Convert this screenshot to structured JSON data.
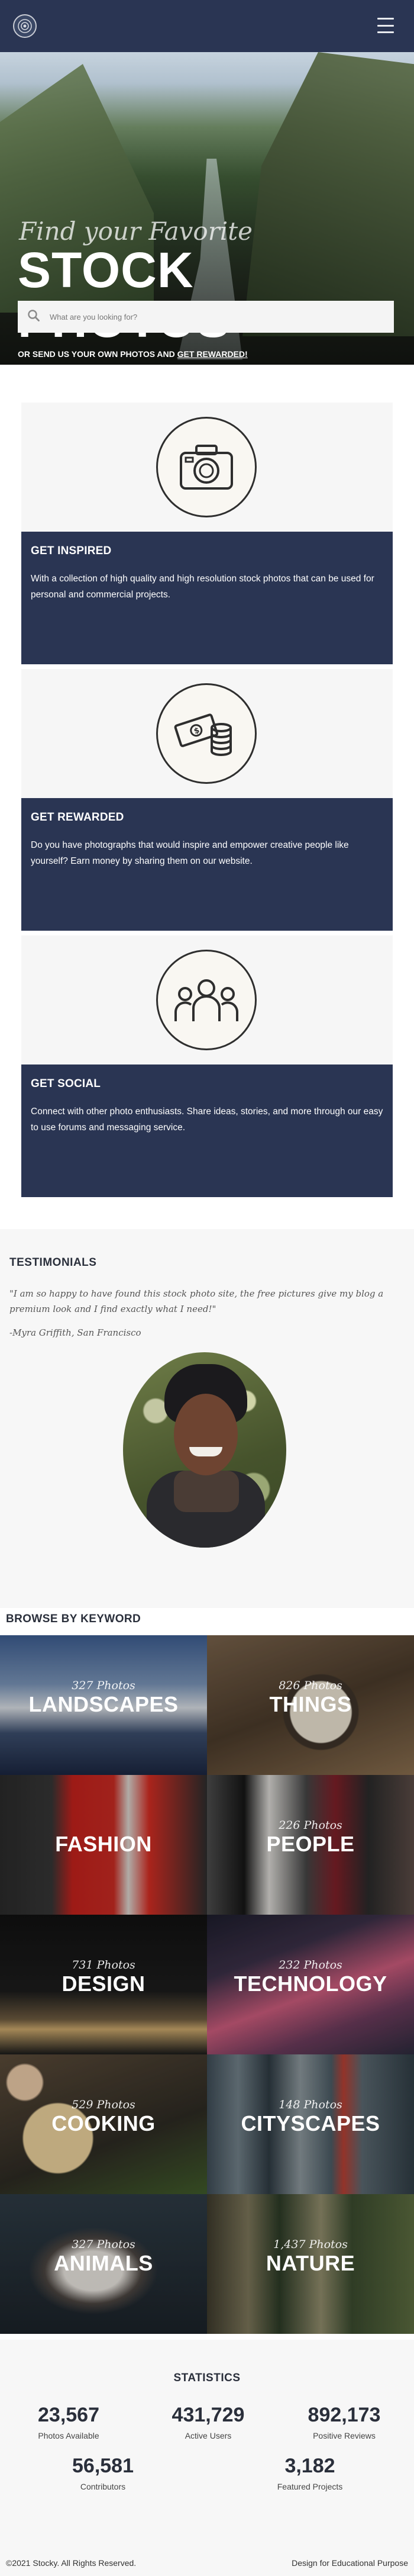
{
  "header": {
    "logo_icon": "camera-aperture-logo",
    "menu_icon": "hamburger-menu-icon",
    "background": "#2a3553"
  },
  "hero": {
    "subtitle": "Find your Favorite",
    "title": "STOCK PHOTOS",
    "search_placeholder": "What are you looking for?",
    "cta_text": "OR SEND US YOUR OWN PHOTOS AND ",
    "cta_link": "GET REWARDED!"
  },
  "features": [
    {
      "icon": "camera-icon",
      "title": "GET INSPIRED",
      "text": "With a collection of high quality and high resolution stock photos that can be used for personal and commercial projects."
    },
    {
      "icon": "money-coins-icon",
      "title": "GET REWARDED",
      "text": "Do you have photographs that would inspire and empower creative people like yourself? Earn money by sharing them on our website."
    },
    {
      "icon": "people-group-icon",
      "title": "GET SOCIAL",
      "text": "Connect with other photo enthusiasts. Share ideas, stories, and more through our easy to use forums and messaging service."
    }
  ],
  "testimonials": {
    "heading": "TESTIMONIALS",
    "quote": "\"I am so happy to have found this stock photo site, the free pictures give my blog a premium look and I find exactly what I need!\"",
    "author": "-Myra Griffith, San Francisco"
  },
  "keywords": {
    "heading": "BROWSE BY KEYWORD",
    "tiles": [
      {
        "count": "327 Photos",
        "name": "LANDSCAPES"
      },
      {
        "count": "826 Photos",
        "name": "THINGS"
      },
      {
        "count": "",
        "name": "FASHION"
      },
      {
        "count": "226 Photos",
        "name": "PEOPLE"
      },
      {
        "count": "731 Photos",
        "name": "DESIGN"
      },
      {
        "count": "232 Photos",
        "name": "TECHNOLOGY"
      },
      {
        "count": "529 Photos",
        "name": "COOKING"
      },
      {
        "count": "148 Photos",
        "name": "CITYSCAPES"
      },
      {
        "count": "327 Photos",
        "name": "ANIMALS"
      },
      {
        "count": "1,437 Photos",
        "name": "NATURE"
      }
    ]
  },
  "statistics": {
    "heading": "STATISTICS",
    "items": [
      {
        "value": "23,567",
        "label": "Photos Available"
      },
      {
        "value": "431,729",
        "label": "Active Users"
      },
      {
        "value": "892,173",
        "label": "Positive Reviews"
      },
      {
        "value": "56,581",
        "label": "Contributors"
      },
      {
        "value": "3,182",
        "label": "Featured Projects"
      }
    ]
  },
  "footer": {
    "copyright": "©2021 Stocky. All Rights Reserved.",
    "note": "Design for Educational Purpose"
  }
}
